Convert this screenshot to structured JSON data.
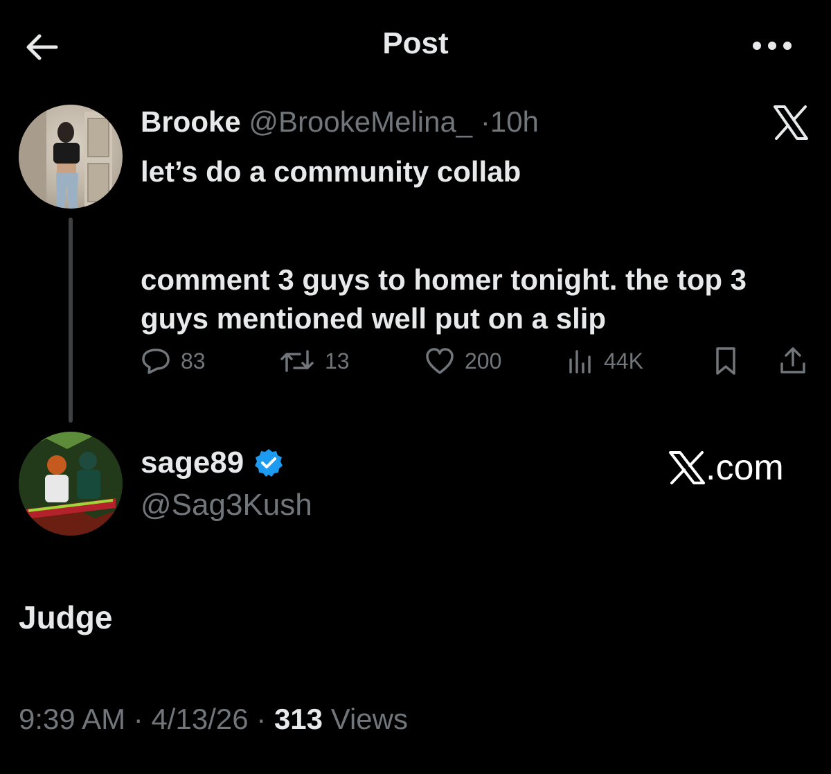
{
  "header": {
    "title": "Post"
  },
  "original_post": {
    "display_name": "Brooke",
    "handle": "@BrookeMelina_",
    "separator": "·",
    "time_ago": "10h",
    "text_line1": "let’s do a community collab",
    "text_line2": "comment 3 guys to homer tonight. the top 3 guys mentioned well put on a slip",
    "stats": {
      "replies": "83",
      "reposts": "13",
      "likes": "200",
      "views": "44K"
    }
  },
  "reply_post": {
    "display_name": "sage89",
    "verified": true,
    "handle": "@Sag3Kush",
    "site_label": ".com",
    "text": "Judge",
    "time": "9:39 AM",
    "separator": "·",
    "date": "4/13/26",
    "views_count": "313",
    "views_label": "Views"
  },
  "colors": {
    "background": "#000000",
    "primary_text": "#e7e9ea",
    "secondary_text": "#71767b",
    "verified_badge": "#1d9bf0",
    "thread_line": "#3e4144"
  },
  "icons": {
    "back": "arrow-left-icon",
    "more": "more-horizontal-icon",
    "brand": "x-logo-icon",
    "reply": "speech-bubble-icon",
    "repost": "repost-arrows-icon",
    "like": "heart-icon",
    "views": "bar-chart-icon",
    "bookmark": "bookmark-icon",
    "share": "share-upload-icon",
    "verified": "verified-badge-icon"
  }
}
